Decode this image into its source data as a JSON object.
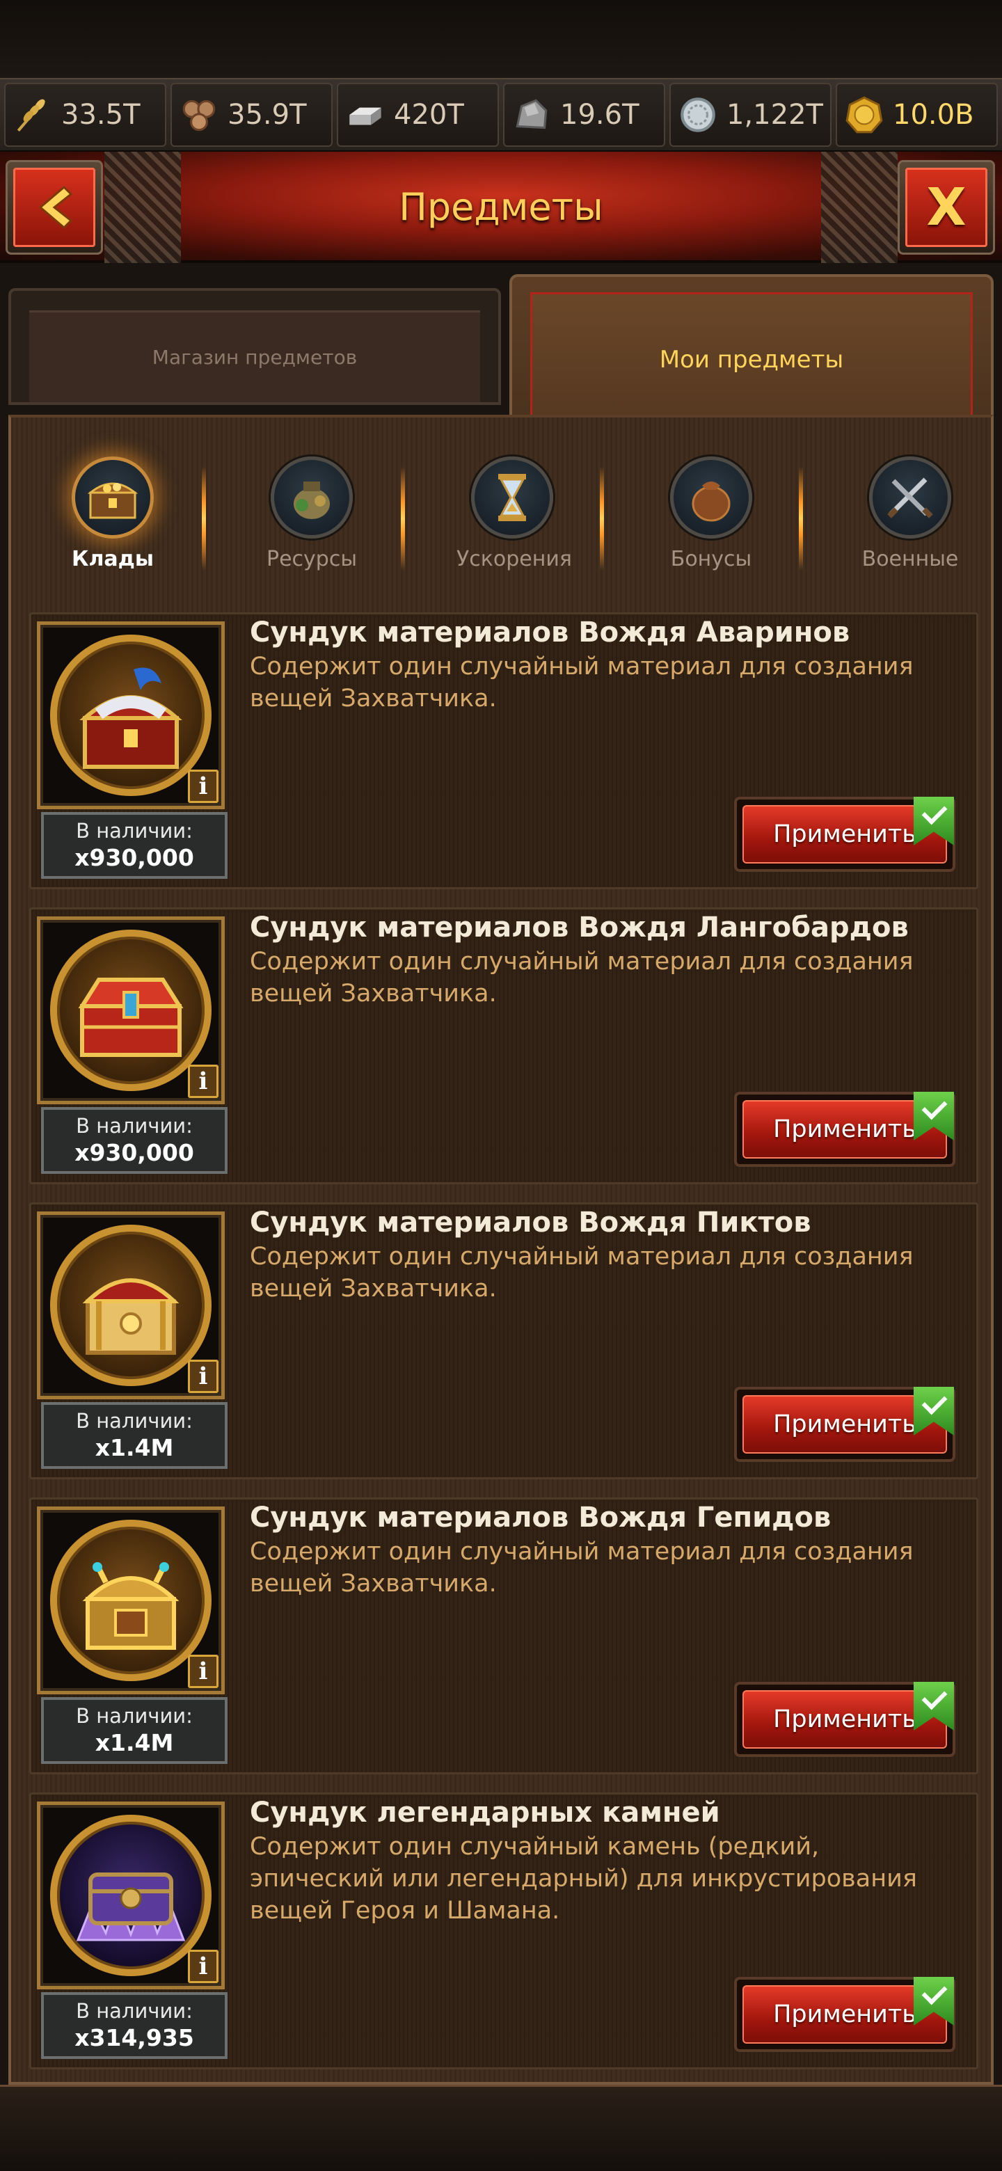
{
  "resources": [
    {
      "name": "wheat-icon",
      "value": "33.5T"
    },
    {
      "name": "wood-icon",
      "value": "35.9T"
    },
    {
      "name": "iron-icon",
      "value": "420T"
    },
    {
      "name": "stone-icon",
      "value": "19.6T"
    },
    {
      "name": "silver-icon",
      "value": "1,122T"
    },
    {
      "name": "gold-coin-icon",
      "value": "10.0B"
    }
  ],
  "header": {
    "title": "Предметы",
    "back_icon": "chevron-left-icon",
    "close_label": "X"
  },
  "tabs": {
    "shop": "Магазин предметов",
    "mine": "Мои предметы"
  },
  "categories": [
    {
      "label": "Клады",
      "icon": "treasure-chest-icon",
      "active": true
    },
    {
      "label": "Ресурсы",
      "icon": "resources-sack-icon",
      "active": false
    },
    {
      "label": "Ускорения",
      "icon": "hourglass-icon",
      "active": false
    },
    {
      "label": "Бонусы",
      "icon": "bonus-bag-icon",
      "active": false
    },
    {
      "label": "Военные",
      "icon": "crossed-swords-icon",
      "active": false
    }
  ],
  "items": [
    {
      "name": "Сундук материалов Вождя Аваринов",
      "desc": "Содержит один случайный материал для создания вещей Захватчика.",
      "stock_label": "В наличии:",
      "stock": "x930,000",
      "apply": "Применить",
      "chest_color": "#c7952d"
    },
    {
      "name": "Сундук материалов Вождя Лангобардов",
      "desc": "Содержит один случайный материал для создания вещей Захватчика.",
      "stock_label": "В наличии:",
      "stock": "x930,000",
      "apply": "Применить",
      "chest_color": "#b8261a"
    },
    {
      "name": "Сундук материалов Вождя Пиктов",
      "desc": "Содержит один случайный материал для создания вещей Захватчика.",
      "stock_label": "В наличии:",
      "stock": "x1.4M",
      "apply": "Применить",
      "chest_color": "#a8201a"
    },
    {
      "name": "Сундук материалов Вождя Гепидов",
      "desc": "Содержит один случайный материал для создания вещей Захватчика.",
      "stock_label": "В наличии:",
      "stock": "x1.4M",
      "apply": "Применить",
      "chest_color": "#d8a23a"
    },
    {
      "name": "Сундук легендарных камней",
      "desc": "Содержит один случайный камень (редкий, эпический или легендарный) для инкрустирования вещей Героя и Шамана.",
      "stock_label": "В наличии:",
      "stock": "x314,935",
      "apply": "Применить",
      "chest_color": "#6a3fa8"
    }
  ],
  "colors": {
    "accent_gold": "#ffd45a",
    "apply_red": "#c41e12",
    "check_green": "#3ea82a"
  }
}
